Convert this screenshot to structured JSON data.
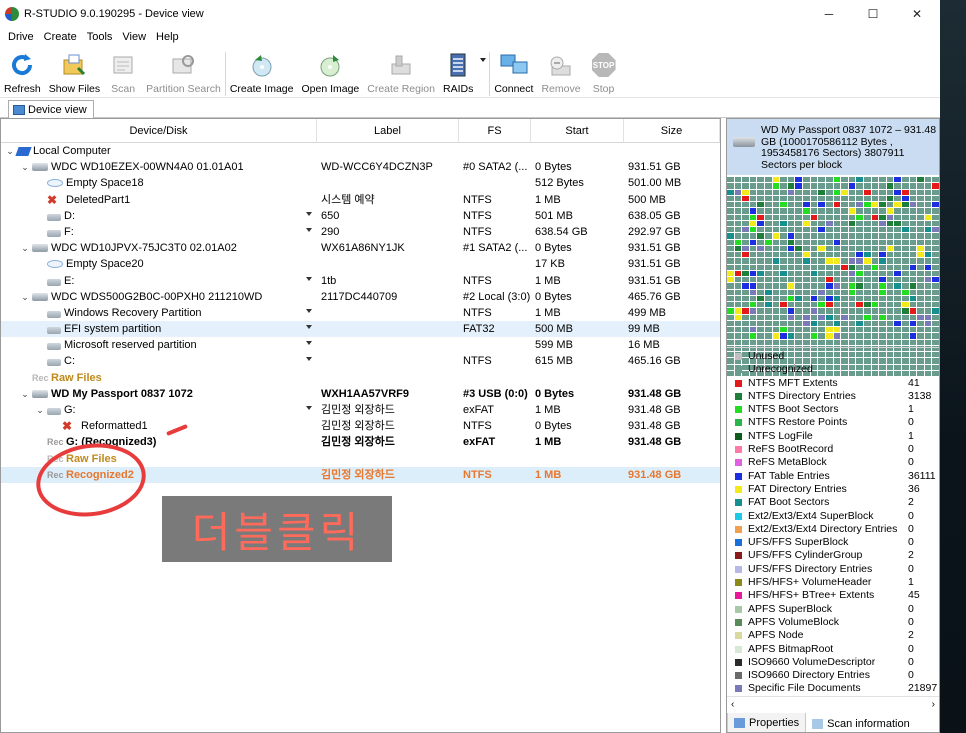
{
  "window": {
    "title": "R-STUDIO 9.0.190295 - Device view",
    "minimize": "─",
    "maximize": "☐",
    "close": "✕"
  },
  "menu": [
    "Drive",
    "Create",
    "Tools",
    "View",
    "Help"
  ],
  "toolbar": {
    "refresh": "Refresh",
    "show_files": "Show Files",
    "scan": "Scan",
    "partition_search": "Partition Search",
    "create_image": "Create Image",
    "open_image": "Open Image",
    "create_region": "Create Region",
    "raids": "RAIDs",
    "connect": "Connect",
    "remove": "Remove",
    "stop": "Stop",
    "stop_icon_text": "STOP"
  },
  "tab": {
    "device_view": "Device view"
  },
  "columns": [
    "Device/Disk",
    "Label",
    "FS",
    "Start",
    "Size"
  ],
  "rows": [
    {
      "name": "Local Computer",
      "label": "",
      "fs": "",
      "start": "",
      "size": ""
    },
    {
      "name": "WDC WD10EZEX-00WN4A0 01.01A01",
      "label": "WD-WCC6Y4DCZN3P",
      "fs": "#0 SATA2 (...",
      "start": "0 Bytes",
      "size": "931.51 GB"
    },
    {
      "name": "Empty Space18",
      "label": "",
      "fs": "",
      "start": "512 Bytes",
      "size": "501.00 MB"
    },
    {
      "name": "DeletedPart1",
      "label": "시스템 예약",
      "fs": "NTFS",
      "start": "1 MB",
      "size": "500 MB"
    },
    {
      "name": "D:",
      "label": "650",
      "fs": "NTFS",
      "start": "501 MB",
      "size": "638.05 GB"
    },
    {
      "name": "F:",
      "label": "290",
      "fs": "NTFS",
      "start": "638.54 GB",
      "size": "292.97 GB"
    },
    {
      "name": "WDC WD10JPVX-75JC3T0 02.01A02",
      "label": "WX61A86NY1JK",
      "fs": "#1 SATA2 (...",
      "start": "0 Bytes",
      "size": "931.51 GB"
    },
    {
      "name": "Empty Space20",
      "label": "",
      "fs": "",
      "start": "17 KB",
      "size": "931.51 GB"
    },
    {
      "name": "E:",
      "label": "1tb",
      "fs": "NTFS",
      "start": "1 MB",
      "size": "931.51 GB"
    },
    {
      "name": "WDC WDS500G2B0C-00PXH0 211210WD",
      "label": "2117DC440709",
      "fs": "#2 Local (3:0)",
      "start": "0 Bytes",
      "size": "465.76 GB"
    },
    {
      "name": "Windows Recovery Partition",
      "label": "",
      "fs": "NTFS",
      "start": "1 MB",
      "size": "499 MB"
    },
    {
      "name": "EFI system partition",
      "label": "",
      "fs": "FAT32",
      "start": "500 MB",
      "size": "99 MB"
    },
    {
      "name": "Microsoft reserved partition",
      "label": "",
      "fs": "",
      "start": "599 MB",
      "size": "16 MB"
    },
    {
      "name": "C:",
      "label": "",
      "fs": "NTFS",
      "start": "615 MB",
      "size": "465.16 GB"
    },
    {
      "name": "Raw Files",
      "label": "",
      "fs": "",
      "start": "",
      "size": ""
    },
    {
      "name": "WD My Passport 0837 1072",
      "label": "WXH1AA57VRF9",
      "fs": "#3 USB (0:0)",
      "start": "0 Bytes",
      "size": "931.48 GB"
    },
    {
      "name": "G:",
      "label": "김민정 외장하드",
      "fs": "exFAT",
      "start": "1 MB",
      "size": "931.48 GB"
    },
    {
      "name": "Reformatted1",
      "label": "김민정 외장하드",
      "fs": "NTFS",
      "start": "0 Bytes",
      "size": "931.48 GB"
    },
    {
      "name": "G: (Recognized3)",
      "label": "김민정 외장하드",
      "fs": "exFAT",
      "start": "1 MB",
      "size": "931.48 GB"
    },
    {
      "name": "Raw Files",
      "label": "",
      "fs": "",
      "start": "",
      "size": ""
    },
    {
      "name": "Recognized2",
      "label": "김민정 외장하드",
      "fs": "NTFS",
      "start": "1 MB",
      "size": "931.48 GB"
    }
  ],
  "right_panel": {
    "disk_info": "WD My Passport 0837 1072 – 931.48 GB (1000170586112 Bytes , 1953458176 Sectors) 3807911 Sectors per block",
    "legend": [
      {
        "name": "Unused",
        "count": "",
        "color": "#c0c0c0"
      },
      {
        "name": "Unrecognized",
        "count": "",
        "color": "#6a9c8e"
      },
      {
        "name": "NTFS MFT Extents",
        "count": "41",
        "color": "#e41a1a"
      },
      {
        "name": "NTFS Directory Entries",
        "count": "3138",
        "color": "#1e7f3a"
      },
      {
        "name": "NTFS Boot Sectors",
        "count": "1",
        "color": "#22dd22"
      },
      {
        "name": "NTFS Restore Points",
        "count": "0",
        "color": "#2ab54a"
      },
      {
        "name": "NTFS LogFile",
        "count": "1",
        "color": "#0c5a1c"
      },
      {
        "name": "ReFS BootRecord",
        "count": "0",
        "color": "#ff7aa8"
      },
      {
        "name": "ReFS MetaBlock",
        "count": "0",
        "color": "#e060e0"
      },
      {
        "name": "FAT Table Entries",
        "count": "36111",
        "color": "#1c2ee0"
      },
      {
        "name": "FAT Directory Entries",
        "count": "36",
        "color": "#f2ea1a"
      },
      {
        "name": "FAT Boot Sectors",
        "count": "2",
        "color": "#168f8f"
      },
      {
        "name": "Ext2/Ext3/Ext4 SuperBlock",
        "count": "0",
        "color": "#1ec8e8"
      },
      {
        "name": "Ext2/Ext3/Ext4 Directory Entries",
        "count": "0",
        "color": "#f0a050"
      },
      {
        "name": "UFS/FFS SuperBlock",
        "count": "0",
        "color": "#1a6fd8"
      },
      {
        "name": "UFS/FFS CylinderGroup",
        "count": "2",
        "color": "#8a1a1a"
      },
      {
        "name": "UFS/FFS Directory Entries",
        "count": "0",
        "color": "#b8b8e8"
      },
      {
        "name": "HFS/HFS+ VolumeHeader",
        "count": "1",
        "color": "#8a8a1a"
      },
      {
        "name": "HFS/HFS+ BTree+ Extents",
        "count": "45",
        "color": "#e81a9a"
      },
      {
        "name": "APFS SuperBlock",
        "count": "0",
        "color": "#a8c8a8"
      },
      {
        "name": "APFS VolumeBlock",
        "count": "0",
        "color": "#5a8a5a"
      },
      {
        "name": "APFS Node",
        "count": "2",
        "color": "#d8d8a0"
      },
      {
        "name": "APFS BitmapRoot",
        "count": "0",
        "color": "#d8e8d8"
      },
      {
        "name": "ISO9660 VolumeDescriptor",
        "count": "0",
        "color": "#2a2a2a"
      },
      {
        "name": "ISO9660 Directory Entries",
        "count": "0",
        "color": "#6a6a6a"
      },
      {
        "name": "Specific File Documents",
        "count": "21897",
        "color": "#7a7ab8"
      }
    ],
    "tabs": {
      "properties": "Properties",
      "scan_information": "Scan information"
    }
  },
  "annotation": {
    "callout_text": "더블클릭"
  }
}
